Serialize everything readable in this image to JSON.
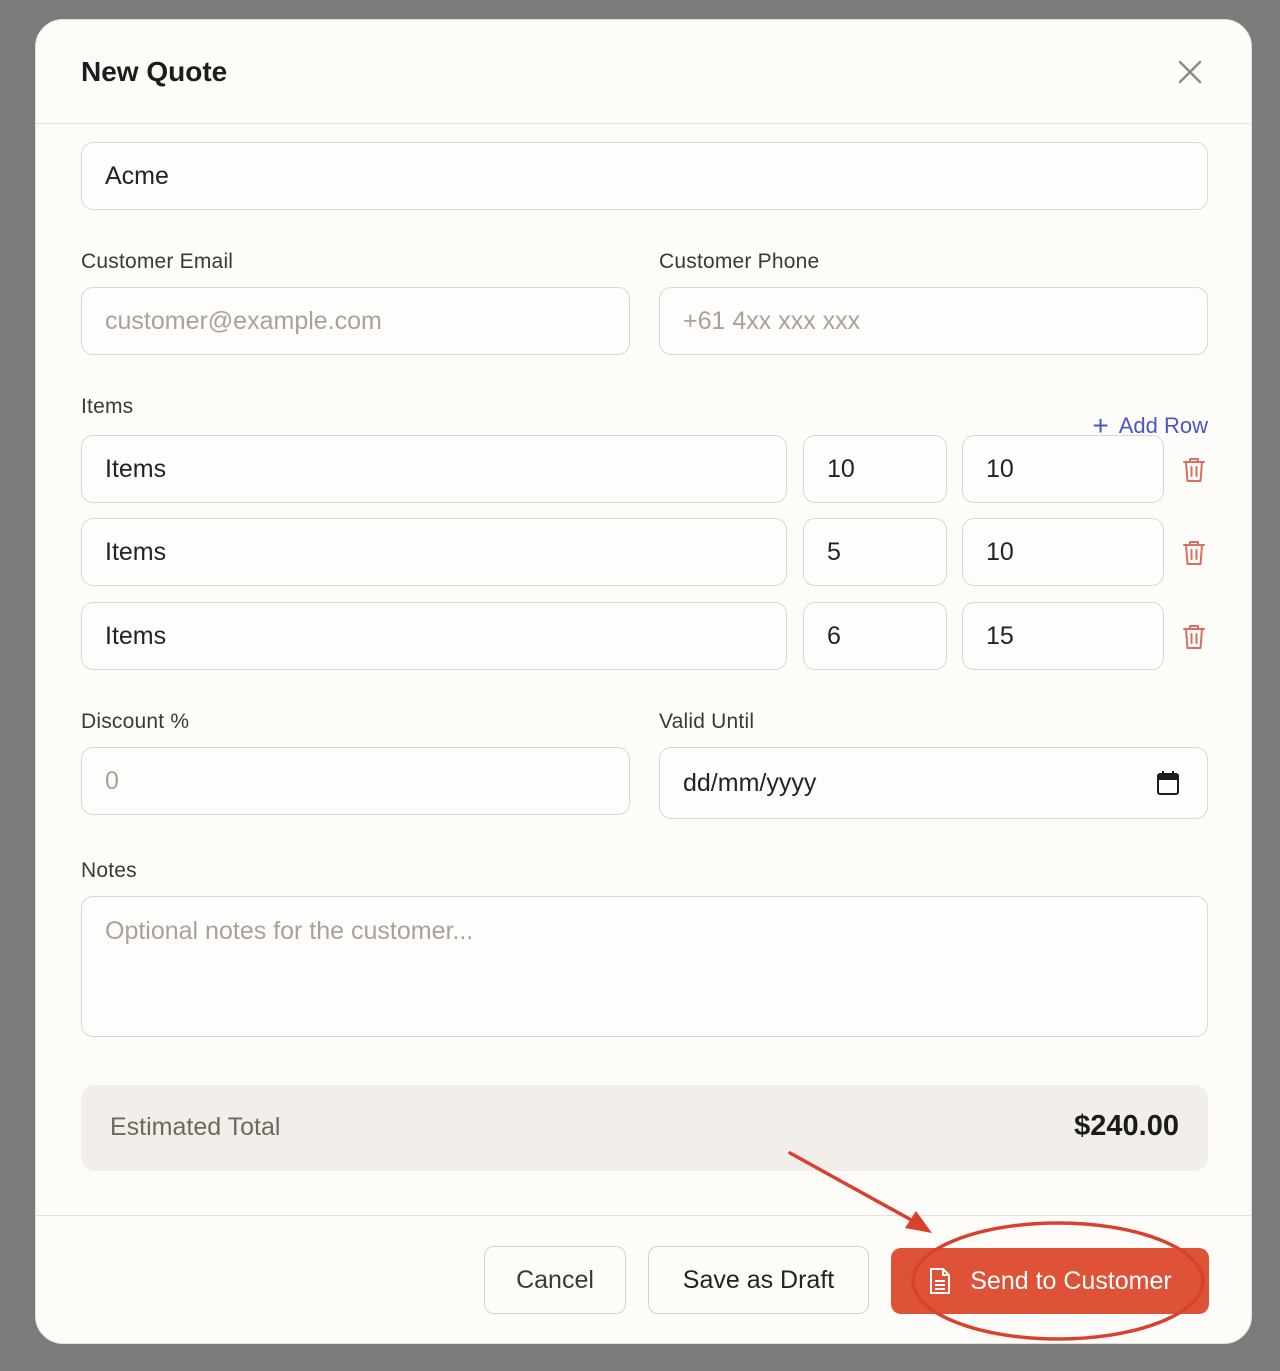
{
  "dialog": {
    "title": "New Quote"
  },
  "form": {
    "customer_name_value": "Acme",
    "customer_email_label": "Customer Email",
    "customer_email_placeholder": "customer@example.com",
    "customer_phone_label": "Customer Phone",
    "customer_phone_placeholder": "+61 4xx xxx xxx",
    "items_label": "Items",
    "add_row_label": "Add Row",
    "items": [
      {
        "description": "Items",
        "quantity": "10",
        "price": "10"
      },
      {
        "description": "Items",
        "quantity": "5",
        "price": "10"
      },
      {
        "description": "Items",
        "quantity": "6",
        "price": "15"
      }
    ],
    "discount_label": "Discount %",
    "discount_placeholder": "0",
    "valid_until_label": "Valid Until",
    "valid_until_value": "dd/mm/yyyy",
    "notes_label": "Notes",
    "notes_placeholder": "Optional notes for the customer..."
  },
  "summary": {
    "estimated_total_label": "Estimated Total",
    "estimated_total_value": "$240.00"
  },
  "footer": {
    "cancel_label": "Cancel",
    "save_draft_label": "Save as Draft",
    "send_label": "Send to Customer"
  },
  "icons": {
    "close": "close-icon",
    "trash": "trash-icon",
    "calendar": "calendar-icon",
    "document": "document-icon",
    "plus": "plus-icon"
  },
  "colors": {
    "accent": "#de5337",
    "link": "#4a56c6",
    "danger_icon": "#d9705f",
    "annotation": "#d9412c"
  }
}
